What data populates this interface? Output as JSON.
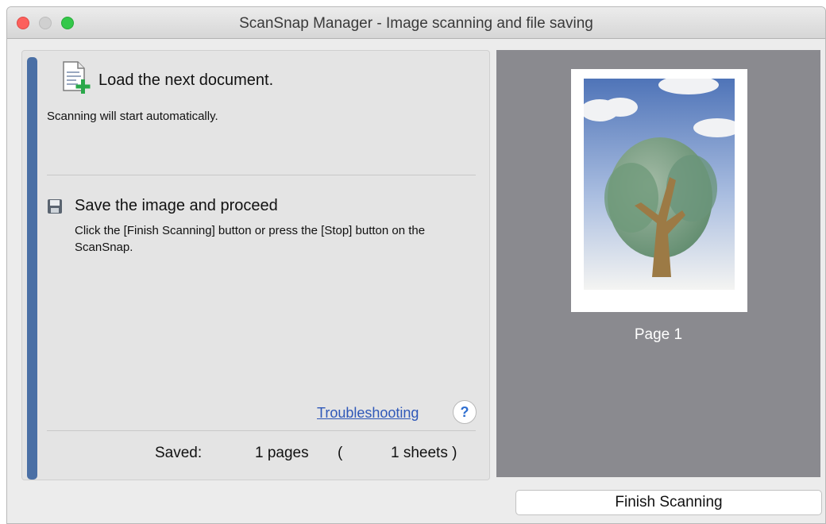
{
  "window": {
    "title": "ScanSnap Manager - Image scanning and file saving"
  },
  "load_step": {
    "title": "Load the next document.",
    "subtitle": "Scanning will start automatically."
  },
  "save_step": {
    "title": "Save the image and proceed",
    "description": "Click the [Finish Scanning] button or press the [Stop] button on the ScanSnap."
  },
  "troubleshooting": {
    "link_label": "Troubleshooting",
    "help_label": "?"
  },
  "saved": {
    "label": "Saved:",
    "pages": "1 pages",
    "open_paren": "(",
    "sheets": "1 sheets )"
  },
  "preview": {
    "page_label": "Page 1"
  },
  "actions": {
    "finish_label": "Finish Scanning"
  },
  "colors": {
    "accent_bar": "#4a6fa5",
    "link": "#2f58b8",
    "preview_bg": "#8a8a8f"
  }
}
